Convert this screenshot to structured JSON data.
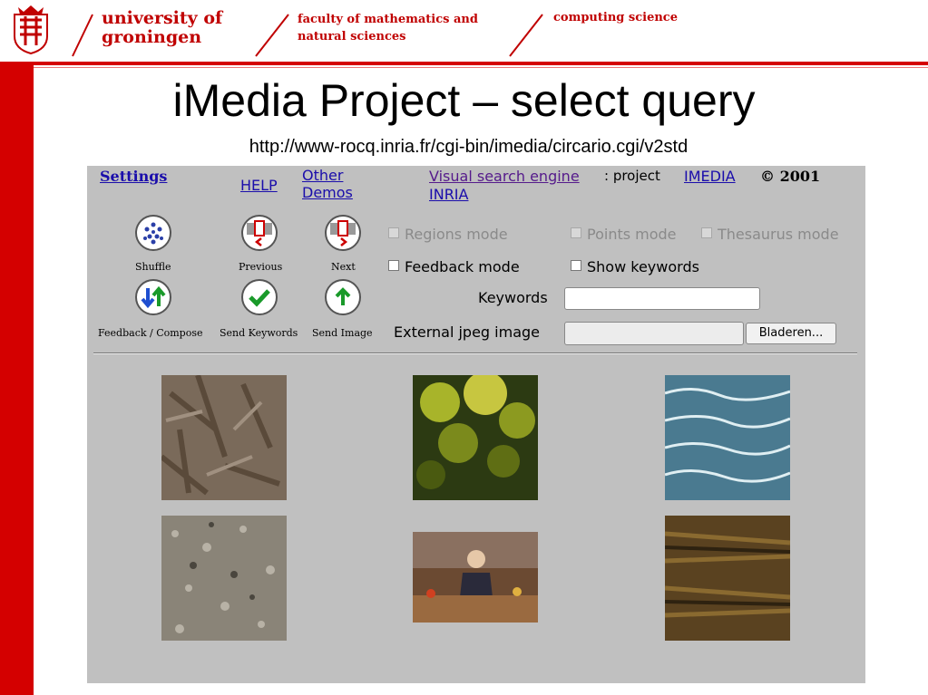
{
  "header": {
    "university": [
      "university of",
      "groningen"
    ],
    "faculty": [
      "faculty of mathematics and",
      "natural sciences"
    ],
    "department": "computing science",
    "color": "#c00000"
  },
  "slide": {
    "title": "iMedia Project – select query",
    "url": "http://www-rocq.inria.fr/cgi-bin/imedia/circario.cgi/v2std"
  },
  "app": {
    "links": {
      "settings": "Settings",
      "help": "HELP",
      "other": "Other",
      "demos": "Demos",
      "visual": "Visual search engine",
      "colon_project": ": project",
      "imedia": "IMEDIA",
      "copyright": "© 2001",
      "inria": "INRIA"
    },
    "icons": {
      "shuffle": "Shuffle",
      "previous": "Previous",
      "next": "Next",
      "feedback": "Feedback / Compose",
      "send_keywords": "Send Keywords",
      "send_image": "Send Image"
    },
    "modes": {
      "regions": "Regions mode",
      "points": "Points mode",
      "thesaurus": "Thesaurus mode",
      "feedback": "Feedback mode",
      "show_keywords": "Show keywords"
    },
    "form": {
      "keywords_label": "Keywords",
      "keywords_value": "",
      "external_label": "External jpeg image",
      "external_value": "",
      "browse": "Bladeren..."
    },
    "thumbnails": [
      "bark-mulch",
      "green-foliage",
      "sea-waves",
      "gravel",
      "bar-painting",
      "brown-texture"
    ]
  }
}
